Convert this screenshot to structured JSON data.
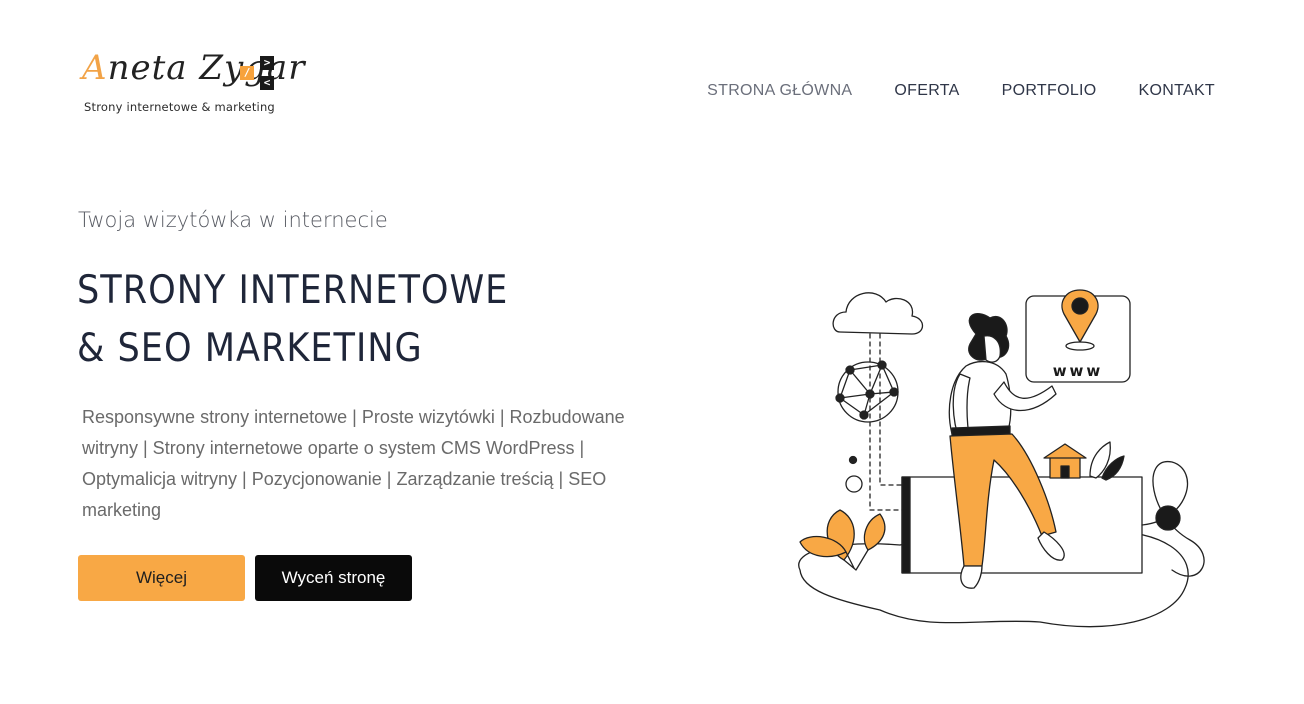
{
  "header": {
    "logo": {
      "script_first": "A",
      "script_rest": "neta Zygar",
      "badge_slash": "/",
      "badge_gt": ">",
      "badge_lt": "<",
      "tagline": "Strony internetowe & marketing"
    },
    "nav": [
      {
        "label": "STRONA GŁÓWNA",
        "active": true
      },
      {
        "label": "OFERTA",
        "active": false
      },
      {
        "label": "PORTFOLIO",
        "active": false
      },
      {
        "label": "KONTAKT",
        "active": false
      }
    ]
  },
  "hero": {
    "subtitle": "Twoja wizytówka w internecie",
    "title_line1": "STRONY INTERNETOWE",
    "title_line2": "& SEO MARKETING",
    "description": "Responsywne strony internetowe | Proste wizytówki | Rozbudowane witryny | Strony internetowe oparte o system CMS WordPress | Optymalicja witryny | Pozycjonowanie | Zarządzanie treścią | SEO marketing",
    "buttons": {
      "more": "Więcej",
      "quote": "Wyceń stronę"
    }
  },
  "illustration": {
    "www_label": "www"
  },
  "colors": {
    "accent": "#f8a845",
    "dark": "#1f2639",
    "text_gray": "#6a6a6a",
    "button_dark": "#0a0a0a"
  }
}
